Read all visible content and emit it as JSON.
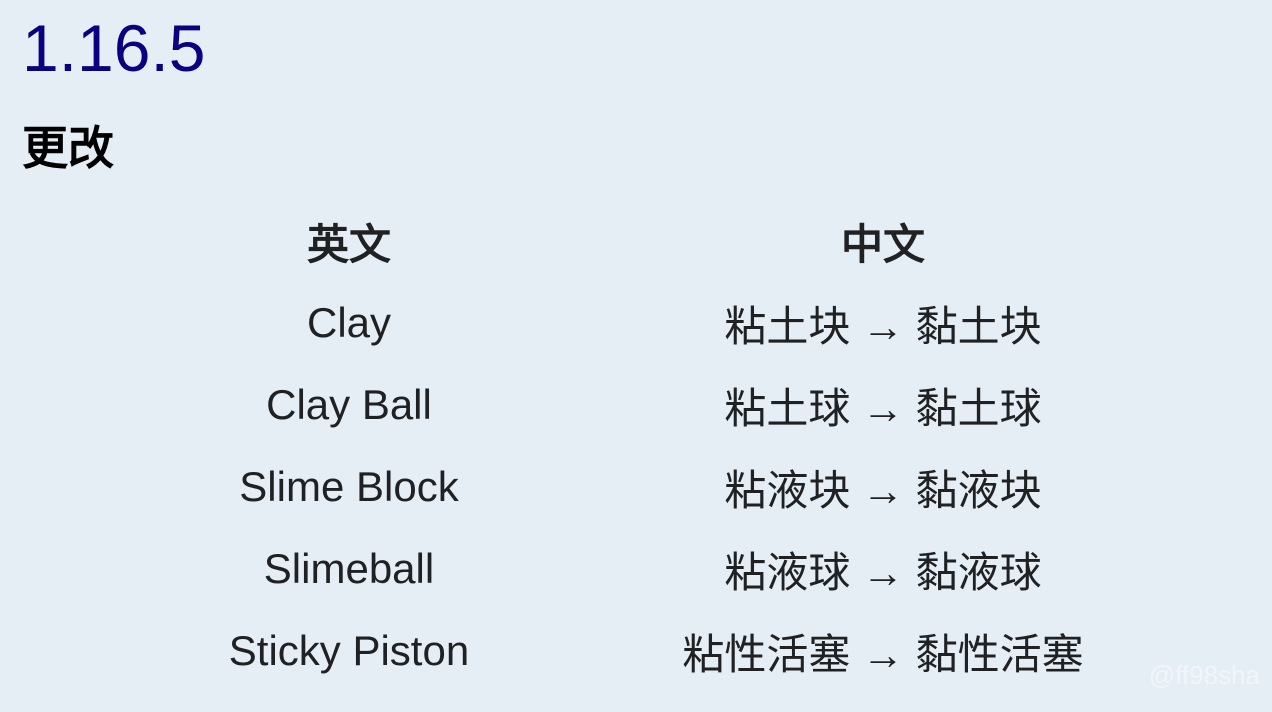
{
  "version_title": "1.16.5",
  "section_title": "更改",
  "table": {
    "headers": [
      "英文",
      "中文"
    ],
    "rows": [
      [
        "Clay",
        "粘土块 → 黏土块"
      ],
      [
        "Clay Ball",
        "粘土球 → 黏土球"
      ],
      [
        "Slime Block",
        "粘液块 → 黏液块"
      ],
      [
        "Slimeball",
        "粘液球 → 黏液球"
      ],
      [
        "Sticky Piston",
        "粘性活塞 → 黏性活塞"
      ]
    ]
  },
  "watermark": "@ff98sha"
}
